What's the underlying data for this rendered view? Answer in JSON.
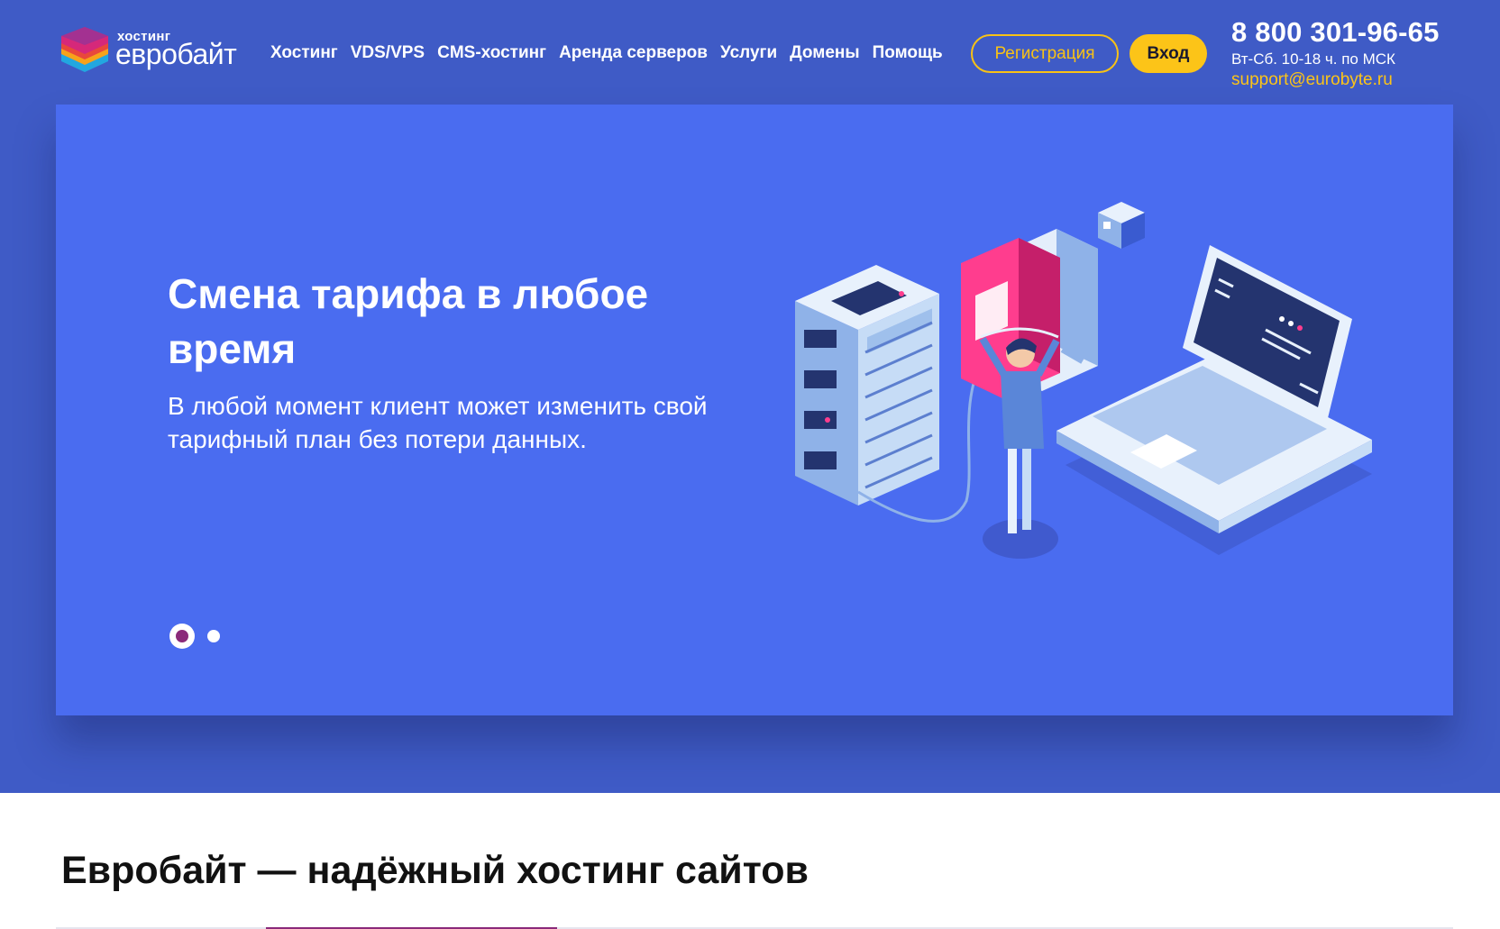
{
  "header": {
    "logo_small": "хостинг",
    "logo_big": "евробайт",
    "nav": [
      "Хостинг",
      "VDS/VPS",
      "CMS-хостинг",
      "Аренда серверов",
      "Услуги",
      "Домены",
      "Помощь"
    ],
    "register_label": "Регистрация",
    "login_label": "Вход",
    "phone": "8 800 301-96-65",
    "hours": "Вт-Сб. 10-18 ч. по МСК",
    "email": "support@eurobyte.ru"
  },
  "hero": {
    "title": "Смена тарифа в любое время",
    "subtitle": "В любой момент клиент может изменить свой тарифный план без потери данных.",
    "slides_total": 2,
    "active_slide": 1,
    "illustration_icon": "server-laptop-illustration"
  },
  "section": {
    "title": "Евробайт — надёжный хостинг сайтов"
  },
  "colors": {
    "header_bg": "#3f5bc6",
    "hero_bg": "#4a6cf0",
    "accent_yellow": "#fcc418",
    "accent_purple": "#8a2a7a"
  }
}
